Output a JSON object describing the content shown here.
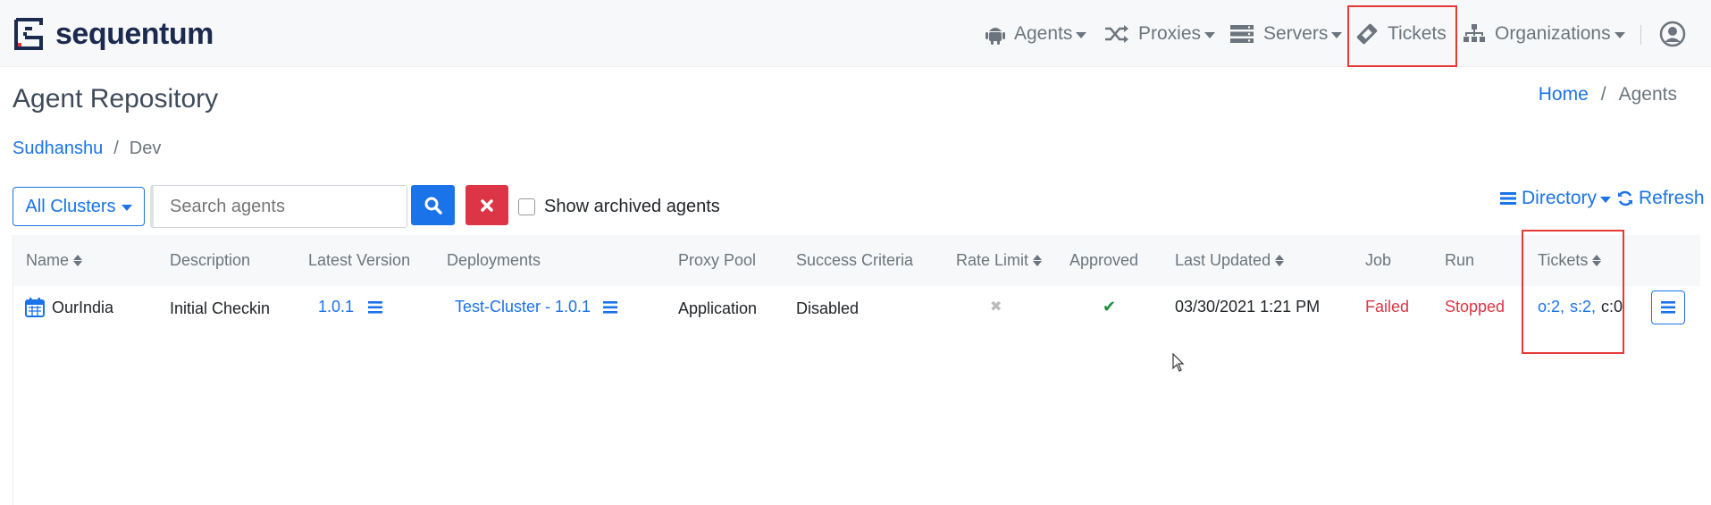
{
  "navbar": {
    "brand": "sequentum",
    "items": [
      {
        "label": "Agents",
        "icon": "android-icon"
      },
      {
        "label": "Proxies",
        "icon": "shuffle-icon"
      },
      {
        "label": "Servers",
        "icon": "server-icon"
      },
      {
        "label": "Tickets",
        "icon": "ticket-icon"
      },
      {
        "label": "Organizations",
        "icon": "sitemap-icon"
      }
    ],
    "user_icon": "user-circle-icon"
  },
  "page": {
    "title": "Agent Repository",
    "breadcrumb": [
      "Home",
      "/",
      "Agents"
    ],
    "sub_breadcrumb": [
      "Sudhanshu",
      "/",
      "Dev"
    ]
  },
  "toolbar": {
    "clusters_label": "All Clusters",
    "search_placeholder": "Search agents",
    "archived_label": "Show archived agents",
    "directory_label": "Directory",
    "refresh_label": "Refresh"
  },
  "table": {
    "headers": [
      "Name",
      "Description",
      "Latest Version",
      "Deployments",
      "Proxy Pool",
      "Success Criteria",
      "Rate Limit",
      "Approved",
      "Last Updated",
      "Job",
      "Run",
      "Tickets"
    ],
    "rows": [
      {
        "name": "OurIndia",
        "description": "Initial Checkin",
        "latest_version": "1.0.1",
        "deployments": "Test-Cluster - 1.0.1",
        "proxy_pool": "Application",
        "success_criteria": "Disabled",
        "rate_limit": "✖",
        "approved": "✔",
        "last_updated": "03/30/2021 1:21 PM",
        "job": "Failed",
        "run": "Stopped",
        "tickets_open": "o:2,",
        "tickets_s": "s:2,",
        "tickets_c": "c:0"
      }
    ]
  },
  "colors": {
    "primary": "#1a73e8",
    "danger": "#dc3545",
    "success": "#1e8e3e",
    "highlight": "#e53935"
  }
}
